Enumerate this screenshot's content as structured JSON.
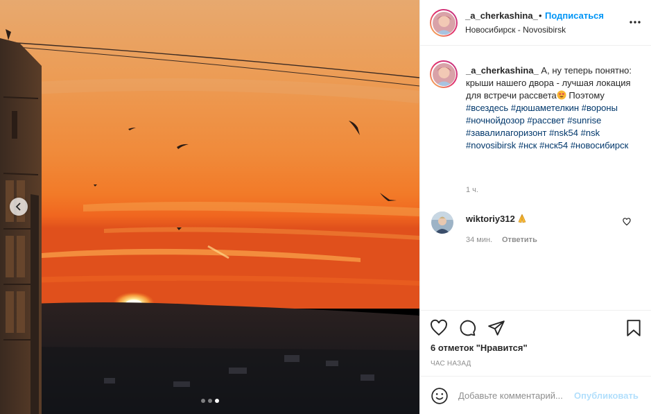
{
  "post": {
    "author": {
      "username": "_a_cherkashina_",
      "separator": "•",
      "follow_label": "Подписаться",
      "location": "Новосибирск - Novosibirsk"
    },
    "caption": {
      "username": "_a_cherkashina_",
      "text_1": "А, ну теперь понятно: крыши нашего двора - лучшая локация для встречи рассвета",
      "emoji": "heart-eyes-emoji",
      "text_2": " Поэтому ",
      "hashtags": [
        "#всездесь",
        "#дюшаметелкин",
        "#вороны",
        "#ночнойдозор",
        "#рассвет",
        "#sunrise",
        "#завалилагоризонт",
        "#nsk54",
        "#nsk",
        "#novosibirsk",
        "#нск",
        "#нск54",
        "#новосибирск"
      ],
      "time": "1 ч."
    },
    "comment": {
      "username": "wiktoriy312",
      "emoji": "praying-hands-emoji",
      "time": "34 мин.",
      "reply_label": "Ответить"
    },
    "likes": "6 отметок \"Нравится\"",
    "posted_ago": "ЧАС НАЗАД",
    "add_comment": {
      "placeholder": "Добавьте комментарий...",
      "publish_label": "Опубликовать"
    },
    "carousel": {
      "count": 3,
      "active_index": 2
    }
  },
  "colors": {
    "accent": "#0095f6",
    "hashtag": "#00376b",
    "muted": "#8e8e8e",
    "publish_disabled": "#b2dffc"
  }
}
